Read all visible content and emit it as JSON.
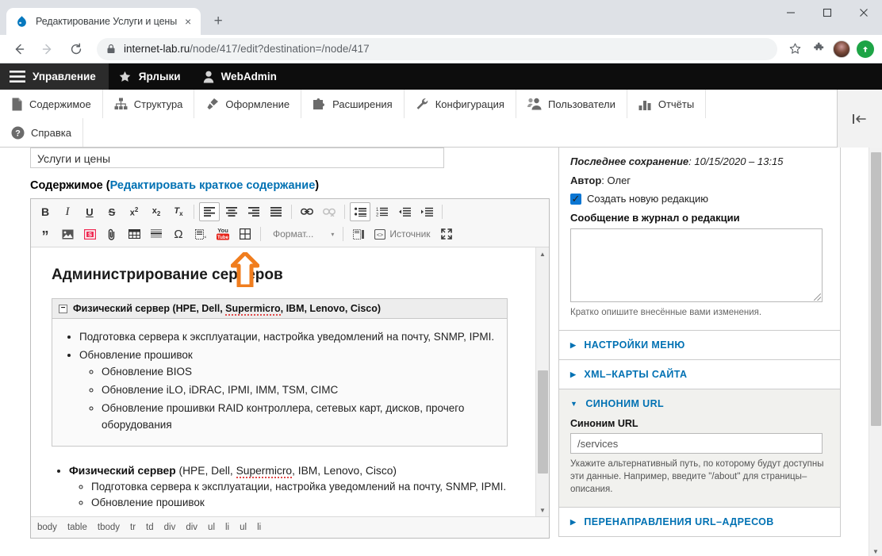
{
  "browser": {
    "tab": {
      "title": "Редактирование Услуги и цены",
      "favicon": "drupal-drop-icon",
      "close": "×"
    },
    "newtab_label": "+",
    "window_controls": {
      "minimize": "—",
      "maximize": "□",
      "close": "✕"
    },
    "nav": {
      "back": "←",
      "forward": "→",
      "reload": "⟳"
    },
    "omnibox": {
      "lock": "lock-icon",
      "url_domain": "internet-lab.ru",
      "url_path": "/node/417/edit?destination=/node/417",
      "url_full": "internet-lab.ru/node/417/edit?destination=/node/417"
    },
    "toolbar_icons": [
      "bookmark-star-icon",
      "extensions-puzzle-icon",
      "profile-avatar",
      "update-arrow-icon"
    ]
  },
  "drupal_toolbar": {
    "items": [
      {
        "label": "Управление",
        "icon": "hamburger-icon",
        "active": true
      },
      {
        "label": "Ярлыки",
        "icon": "star-icon",
        "active": false
      },
      {
        "label": "WebAdmin",
        "icon": "user-icon",
        "active": false
      }
    ]
  },
  "admin_menu": {
    "items": [
      {
        "label": "Содержимое",
        "icon": "document-icon"
      },
      {
        "label": "Структура",
        "icon": "sitemap-icon"
      },
      {
        "label": "Оформление",
        "icon": "paintbrush-icon"
      },
      {
        "label": "Расширения",
        "icon": "puzzle-icon"
      },
      {
        "label": "Конфигурация",
        "icon": "wrench-icon"
      },
      {
        "label": "Пользователи",
        "icon": "users-icon"
      },
      {
        "label": "Отчёты",
        "icon": "bar-chart-icon"
      },
      {
        "label": "Справка",
        "icon": "question-mark-icon"
      }
    ],
    "collapse_icon": "collapse-left-icon"
  },
  "form": {
    "title_value": "Услуги и цены",
    "content_label": "Содержимое",
    "content_link": "(Редактировать краткое содержание)",
    "content_link_open": "(",
    "content_link_text": "Редактировать краткое содержание",
    "content_link_close": ")"
  },
  "editor": {
    "toolbar_row1": [
      {
        "name": "bold",
        "glyph": "B"
      },
      {
        "name": "italic",
        "glyph": "I"
      },
      {
        "name": "underline",
        "glyph": "U"
      },
      {
        "name": "strikethrough",
        "glyph": "S"
      },
      {
        "name": "superscript",
        "glyph": "x²"
      },
      {
        "name": "subscript",
        "glyph": "x₂"
      },
      {
        "name": "remove-format",
        "glyph": "Tx"
      },
      {
        "name": "align-left",
        "glyph": "≡"
      },
      {
        "name": "align-center",
        "glyph": "≡"
      },
      {
        "name": "align-right",
        "glyph": "≡"
      },
      {
        "name": "align-justify",
        "glyph": "≡"
      },
      {
        "name": "link",
        "glyph": "🔗"
      },
      {
        "name": "unlink",
        "glyph": "🔗"
      },
      {
        "name": "bulleted-list",
        "glyph": "•≡"
      },
      {
        "name": "numbered-list",
        "glyph": "1≡"
      },
      {
        "name": "outdent",
        "glyph": "⇤"
      },
      {
        "name": "indent",
        "glyph": "⇥"
      }
    ],
    "toolbar_row2": [
      {
        "name": "blockquote",
        "glyph": "”"
      },
      {
        "name": "image",
        "glyph": "🖼"
      },
      {
        "name": "snippet",
        "glyph": "S"
      },
      {
        "name": "attach-file",
        "glyph": "📎"
      },
      {
        "name": "insert-table",
        "glyph": "▦"
      },
      {
        "name": "horizontal-rule",
        "glyph": "≣"
      },
      {
        "name": "special-character",
        "glyph": "Ω"
      },
      {
        "name": "templates",
        "glyph": "▤"
      },
      {
        "name": "youtube",
        "glyph": "You Tube"
      },
      {
        "name": "insert-grid",
        "glyph": "⊞"
      }
    ],
    "format_dropdown": {
      "label": "Формат...",
      "caret": "▾"
    },
    "source_button": {
      "label": "Источник",
      "icon": "source-code-icon"
    },
    "maximize_button": {
      "icon": "maximize-icon"
    },
    "show_blocks_button": {
      "icon": "show-blocks-icon"
    },
    "youtube_label_top": "You",
    "youtube_label_bottom": "Tube",
    "element_path": [
      "body",
      "table",
      "tbody",
      "tr",
      "td",
      "div",
      "div",
      "ul",
      "li",
      "ul",
      "li"
    ],
    "content": {
      "heading": "Администрирование серверов",
      "table_header": "Физический сервер (HPE, Dell, Supermicro, IBM, Lenovo, Cisco)",
      "table_header_parts": {
        "bold_prefix": "Физический сервер ",
        "rest_before_spell": "(HPE, Dell, ",
        "spell": "Supermicro",
        "rest_after_spell": ", IBM, Lenovo, Cisco)"
      },
      "bullets": [
        "Подготовка сервера к эксплуатации, настройка уведомлений на почту, SNMP, IPMI.",
        "Обновление прошивок"
      ],
      "sub_bullets": [
        "Обновление BIOS",
        "Обновление iLO, iDRAC, IPMI, IMM, TSM, CIMC",
        "Обновление прошивки RAID контроллера, сетевых карт, дисков, прочего оборудования"
      ],
      "outer_item_bold": "Физический сервер",
      "outer_item_rest_before": " (HPE, Dell, ",
      "outer_item_spell": "Supermicro",
      "outer_item_rest_after": ", IBM, Lenovo, Cisco)",
      "outer_sub": [
        "Подготовка сервера к эксплуатации, настройка уведомлений на почту, SNMP, IPMI.",
        "Обновление прошивок"
      ]
    }
  },
  "sidebar": {
    "last_saved_label": "Последнее сохранение",
    "last_saved_value": ": 10/15/2020 – 13:15",
    "author_label": "Автор",
    "author_value": ": Олег",
    "new_revision_label": "Создать новую редакцию",
    "new_revision_checked": true,
    "revision_log_label": "Сообщение в журнал о редакции",
    "revision_log_value": "",
    "revision_log_help": "Кратко опишите внесённые вами изменения.",
    "sections": [
      {
        "label": "НАСТРОЙКИ МЕНЮ",
        "open": false,
        "tri": "▶"
      },
      {
        "label": "XML–КАРТЫ САЙТА",
        "open": false,
        "tri": "▶"
      },
      {
        "label": "СИНОНИМ URL",
        "open": true,
        "tri": "▼"
      },
      {
        "label": "ПЕРЕНАПРАВЛЕНИЯ URL–АДРЕСОВ",
        "open": false,
        "tri": "▶"
      }
    ],
    "url_alias": {
      "field_label": "Синоним URL",
      "value": "/services",
      "help": "Укажите альтернативный путь, по которому будут доступны эти данные. Например, введите \"/about\" для страницы–описания."
    }
  },
  "annotation": {
    "arrow_color": "#F07D1E",
    "points_to": "insert-grid-button"
  },
  "colors": {
    "accent_blue": "#0071b3",
    "toolbar_black": "#0d0d0d",
    "checkbox_blue": "#0b76d3",
    "arrow_orange": "#F07D1E"
  }
}
